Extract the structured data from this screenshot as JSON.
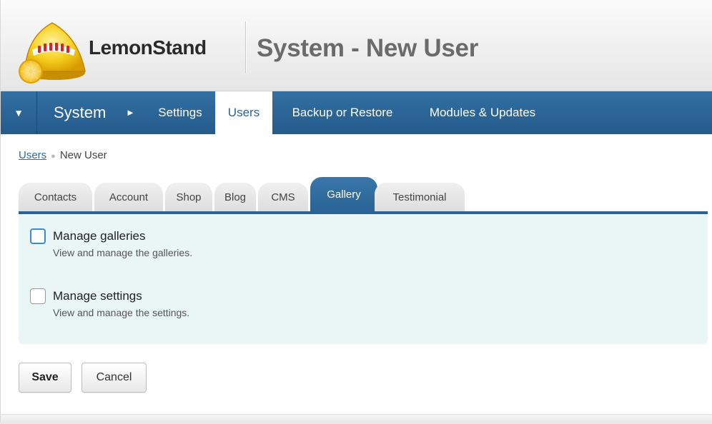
{
  "header": {
    "brand": "LemonStand",
    "page_title": "System - New User"
  },
  "nav": {
    "toggle_icon": "triangle-down",
    "section": "System",
    "section_arrow": "►",
    "items": [
      {
        "label": "Settings",
        "active": false
      },
      {
        "label": "Users",
        "active": true
      },
      {
        "label": "Backup or Restore",
        "active": false
      },
      {
        "label": "Modules & Updates",
        "active": false
      }
    ]
  },
  "breadcrumb": {
    "link": "Users",
    "current": "New User"
  },
  "tabs": [
    {
      "label": "Contacts",
      "active": false
    },
    {
      "label": "Account",
      "active": false
    },
    {
      "label": "Shop",
      "active": false
    },
    {
      "label": "Blog",
      "active": false
    },
    {
      "label": "CMS",
      "active": false
    },
    {
      "label": "Gallery",
      "active": true
    },
    {
      "label": "Testimonial",
      "active": false
    }
  ],
  "permissions": [
    {
      "label": "Manage galleries",
      "description": "View and manage the galleries.",
      "checked": false,
      "focused": true
    },
    {
      "label": "Manage settings",
      "description": "View and manage the settings.",
      "checked": false,
      "focused": false
    }
  ],
  "actions": {
    "save": "Save",
    "cancel": "Cancel"
  },
  "colors": {
    "nav_bg": "#2a6496",
    "panel_bg": "#eaf6f6",
    "link": "#2d6aa0"
  }
}
